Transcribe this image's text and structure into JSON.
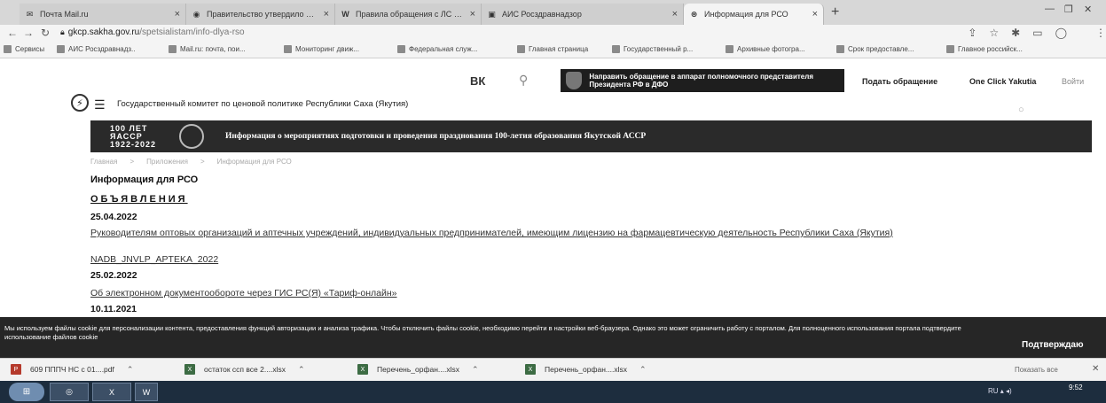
{
  "browser": {
    "tabs": [
      {
        "label": "Почта Mail.ru",
        "icon": "mail-icon"
      },
      {
        "label": "Правительство утвердило нов",
        "icon": "gov-icon"
      },
      {
        "label": "Правила обращения с ЛС и П",
        "icon": "wiki-icon"
      },
      {
        "label": "АИС Росздравнадзор",
        "icon": "ais-icon"
      },
      {
        "label": "Информация для РСО",
        "icon": "site-icon"
      }
    ],
    "active_tab": 4,
    "url_domain": "gkcp.sakha.gov.ru",
    "url_path": "/spetsialistam/info-dlya-rso",
    "bookmarks": [
      "Сервисы",
      "АИС Росздравнадз..",
      "Mail.ru: почта, пои...",
      "Мониторинг движ...",
      "Федеральная служ...",
      "Главная страница",
      "Государственный р...",
      "Архивные фотогра...",
      "Срок предоставле...",
      "Главное российск..."
    ]
  },
  "site": {
    "vk_label": "ВК",
    "appeal_banner": "Направить обращение в аппарат полномочного представителя Президента РФ в ДФО",
    "submit_link": "Подать обращение",
    "oneclick_link": "One Click Yakutia",
    "lang_link": "Войти",
    "title": "Государственный комитет по ценовой политике Республики Саха (Якутия)",
    "anniversary": {
      "logo_line1": "100 ЛЕТ",
      "logo_line2": "ЯАССР",
      "logo_line3": "1922-2022",
      "text": "Информация о мероприятиях подготовки и проведения празднования 100-летия образования Якутской АССР"
    },
    "breadcrumb": [
      "Главная",
      "Приложения",
      "Информация для РСО"
    ],
    "page_title": "Информация для РСО",
    "section_heading": "ОБЪЯВЛЕНИЯ",
    "entries": [
      {
        "date": "25.04.2022"
      },
      {
        "link": "Руководителям оптовых организаций и аптечных учреждений, индивидуальных предпринимателей, имеющим лицензию на фармацевтическую деятельность Республики Саха (Якутия)"
      },
      {
        "link": "NADB_JNVLP_APTEKA_2022"
      },
      {
        "date": "25.02.2022"
      },
      {
        "link": "Об электронном документообороте через ГИС РС(Я) «Тариф-онлайн»"
      },
      {
        "date": "10.11.2021"
      }
    ]
  },
  "cookie": {
    "text": "Мы используем файлы cookie для персонализации контента, предоставления функций авторизации и анализа трафика. Чтобы отключить файлы cookie, необходимо перейти в настройки веб-браузера. Однако это может ограничить работу с порталом. Для полноценного использования портала подтвердите использование файлов cookie",
    "accept": "Подтверждаю"
  },
  "downloads": {
    "items": [
      {
        "name": "609 ПППЧ НС с 01....pdf",
        "type": "pdf"
      },
      {
        "name": "остаток ссп все 2....xlsx",
        "type": "xlsx"
      },
      {
        "name": "Перечень_орфан....xlsx",
        "type": "xlsx"
      },
      {
        "name": "Перечень_орфан....xlsx",
        "type": "xlsx"
      }
    ],
    "show_all": "Показать все"
  },
  "taskbar": {
    "lang": "RU",
    "time": "9:52"
  }
}
